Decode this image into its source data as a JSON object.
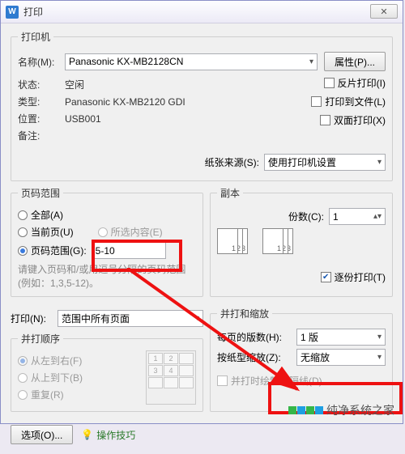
{
  "window": {
    "title": "打印",
    "close_icon": "✕"
  },
  "printer": {
    "legend": "打印机",
    "name_label": "名称(M):",
    "name_value": "Panasonic KX-MB2128CN",
    "properties_btn": "属性(P)...",
    "status_label": "状态:",
    "status_value": "空闲",
    "type_label": "类型:",
    "type_value": "Panasonic KX-MB2120 GDI",
    "where_label": "位置:",
    "where_value": "USB001",
    "comment_label": "备注:",
    "reverse_chk": "反片打印(I)",
    "tofile_chk": "打印到文件(L)",
    "duplex_chk": "双面打印(X)",
    "paper_src_label": "纸张来源(S):",
    "paper_src_value": "使用打印机设置"
  },
  "range": {
    "legend": "页码范围",
    "all": "全部(A)",
    "current": "当前页(U)",
    "selection": "所选内容(E)",
    "pages": "页码范围(G):",
    "pages_value": "5-10",
    "hint1": "请键入页码和/或用逗号分隔的页码范围",
    "hint2": "(例如：1,3,5-12)。"
  },
  "copies": {
    "legend": "副本",
    "count_label": "份数(C):",
    "count_value": "1",
    "collate": "逐份打印(T)"
  },
  "printwhat": {
    "label": "打印(N):",
    "value": "范围中所有页面"
  },
  "zoom": {
    "legend": "并打和缩放",
    "perpage_label": "每页的版数(H):",
    "perpage_value": "1 版",
    "scale_label": "按纸型缩放(Z):",
    "scale_value": "无缩放",
    "drawlines": "并打时绘制分隔线(D)"
  },
  "order": {
    "legend": "并打顺序",
    "lr": "从左到右(F)",
    "tb": "从上到下(B)",
    "repeat": "重复(R)"
  },
  "footer": {
    "options_btn": "选项(O)...",
    "tips": "操作技巧"
  },
  "watermark": "纯净系统之家"
}
